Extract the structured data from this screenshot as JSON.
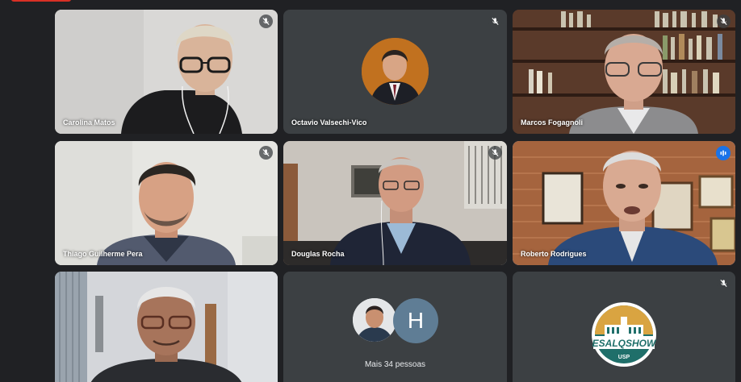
{
  "meeting": {
    "participants": [
      {
        "name": "Carolina Matos",
        "muted": true,
        "speaking": false
      },
      {
        "name": "Octavio Valsechi-Vico",
        "muted": true,
        "speaking": false
      },
      {
        "name": "Marcos Fogagnoli",
        "muted": true,
        "speaking": false
      },
      {
        "name": "Thiago Guilherme Pera",
        "muted": true,
        "speaking": false
      },
      {
        "name": "Douglas Rocha",
        "muted": true,
        "speaking": false
      },
      {
        "name": "Roberto Rodrigues",
        "muted": false,
        "speaking": true
      },
      {
        "name": "",
        "muted": false,
        "speaking": false
      },
      {
        "name": "",
        "muted": false,
        "speaking": false
      },
      {
        "name": "",
        "muted": true,
        "speaking": false
      }
    ],
    "others": {
      "avatar_letter": "H",
      "label": "Mais 34 pessoas"
    },
    "logo": {
      "text_top": "ESALQ",
      "text_bottom": "SHOW",
      "subtitle": "USP"
    }
  },
  "colors": {
    "background": "#202124",
    "tile": "#3c4043",
    "active_border": "#8ab4f8",
    "speaking_badge": "#1a73e8",
    "letter_avatar": "#5f7d95",
    "logo_green": "#1f6f6a",
    "logo_gold": "#d9a441"
  },
  "icons": {
    "mute": "mic-off-icon",
    "speaking": "audio-level-icon"
  }
}
